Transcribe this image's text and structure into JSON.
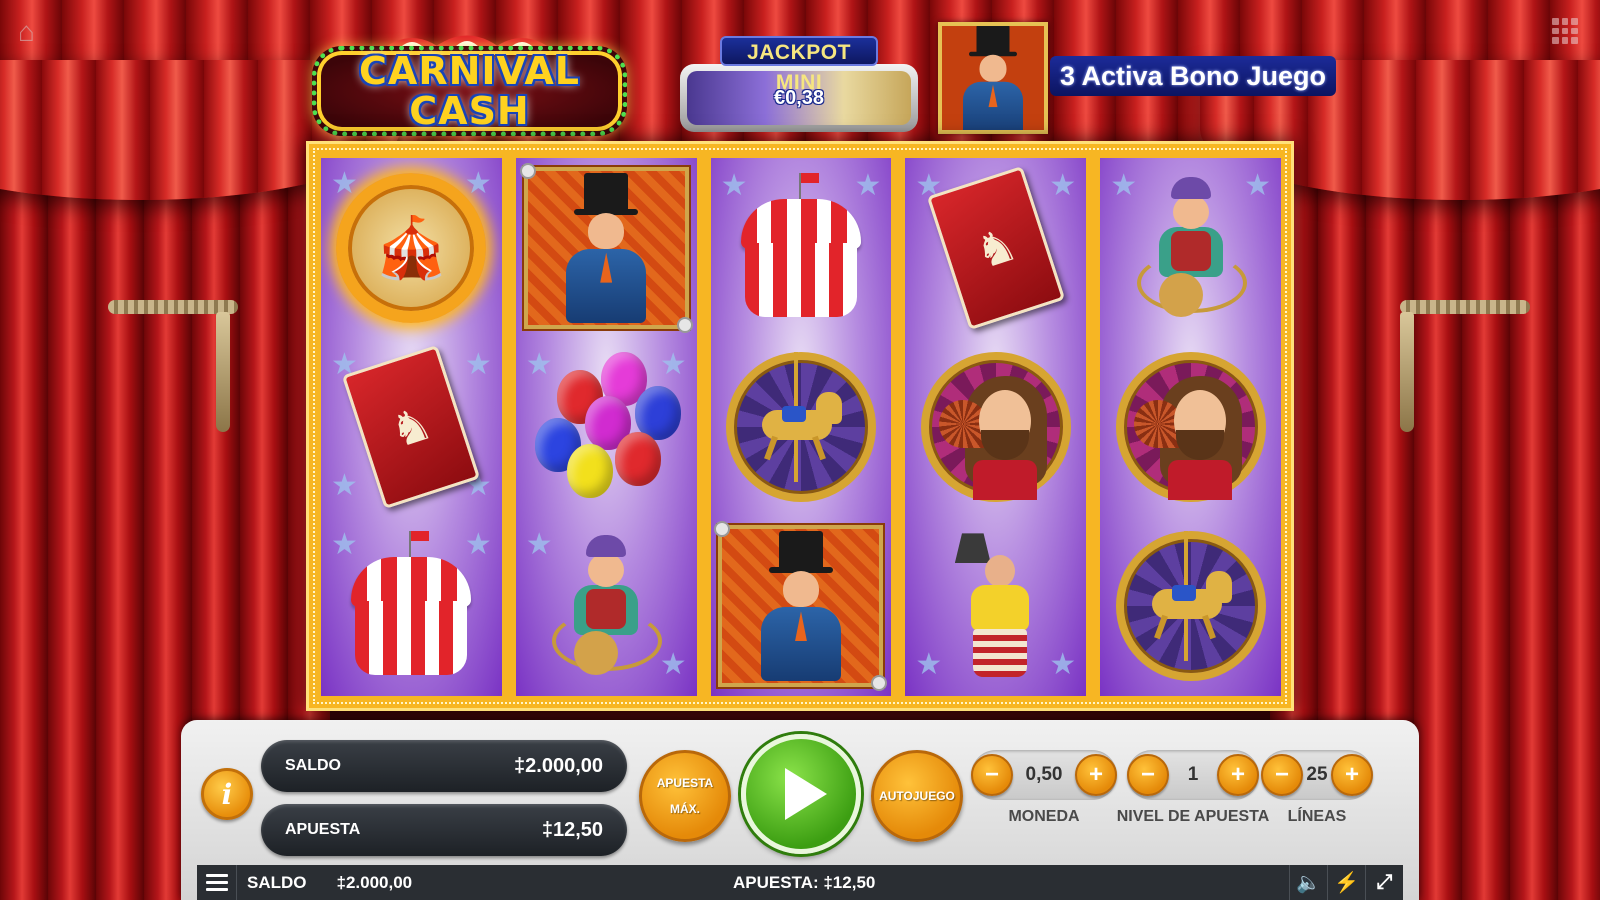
{
  "header": {
    "logo_line1": "CARNIVAL",
    "logo_line2": "CASH",
    "jackpot_title": "JACKPOT MINI",
    "jackpot_value": "€0,38",
    "bonus_text": "3 Activa Bono Juego"
  },
  "icons": {
    "home": "home-icon",
    "apps": "grid-icon",
    "menu": "hamburger-icon",
    "sound": "speaker-icon",
    "turbo": "lightning-icon",
    "fullscreen": "fullscreen-icon"
  },
  "reels": [
    [
      "fire-wagon",
      "red-card",
      "circus-tent"
    ],
    [
      "ringmaster-framed",
      "balloons",
      "monkey-trainer"
    ],
    [
      "circus-tent",
      "carousel-horse",
      "ringmaster-framed"
    ],
    [
      "red-card",
      "bearded-lady",
      "strongman"
    ],
    [
      "monkey-trainer",
      "bearded-lady",
      "carousel-horse"
    ]
  ],
  "panel": {
    "info_label": "i",
    "saldo_label": "SALDO",
    "saldo_value": "‡2.000,00",
    "apuesta_label": "APUESTA",
    "apuesta_value": "‡12,50",
    "max_bet_line1": "APUESTA",
    "max_bet_line2": "MÁX.",
    "autoplay_label": "AUTOJUEGO",
    "moneda_value": "0,50",
    "moneda_label": "MONEDA",
    "nivel_value": "1",
    "nivel_label": "NIVEL DE APUESTA",
    "lineas_value": "25",
    "lineas_label": "LÍNEAS",
    "minus": "−",
    "plus": "+"
  },
  "status_bar": {
    "saldo_label": "SALDO",
    "saldo_value": "‡2.000,00",
    "bet_text": "APUESTA: ‡12,50"
  },
  "colors": {
    "curtain": "#b5161a",
    "reel_frame": "#f7b623",
    "reel_bg": "#7a33c4",
    "spin_button": "#3c9e12",
    "accent_orange": "#e58a09",
    "panel": "#e3e3e3",
    "status_bar": "#2a2e33"
  }
}
